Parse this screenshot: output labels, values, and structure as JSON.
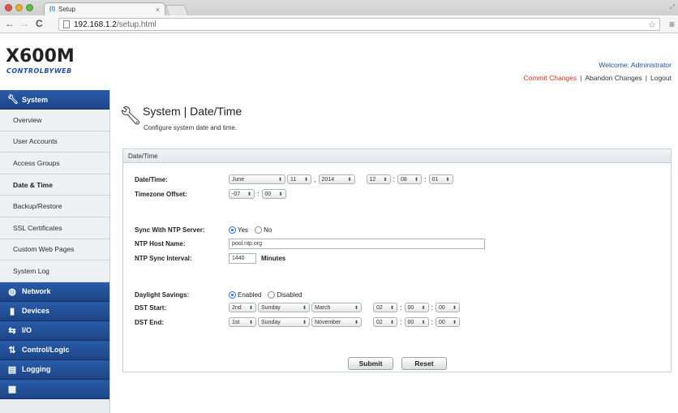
{
  "browser": {
    "tab_title": "Setup",
    "favicon_text": "(!)",
    "url_host": "192.168.1.2",
    "url_path": "/setup.html"
  },
  "colors": {
    "brand_blue": "#1f4d9b",
    "sidebar_section": "#2a5ca8",
    "commit_red": "#d4321f"
  },
  "header": {
    "logo_main": "X600M",
    "logo_sub": "CONTROLBYWEB",
    "welcome": "Welcome: Administrator",
    "commit": "Commit Changes",
    "abandon": "Abandon Changes",
    "logout": "Logout",
    "sep": "|"
  },
  "sidebar": {
    "system": "System",
    "items": [
      "Overview",
      "User Accounts",
      "Access Groups",
      "Date & Time",
      "Backup/Restore",
      "SSL Certificates",
      "Custom Web Pages",
      "System Log"
    ],
    "sections": [
      "Network",
      "Devices",
      "I/O",
      "Control/Logic",
      "Logging"
    ]
  },
  "page": {
    "title": "System | Date/Time",
    "description": "Configure system date and time.",
    "panel_title": "Date/Time"
  },
  "form": {
    "datetime": {
      "label": "Date/Time:",
      "month": "June",
      "day": "11",
      "year": "2014",
      "hour": "12",
      "minute": "08",
      "second": "01"
    },
    "timezone": {
      "label": "Timezone Offset:",
      "hours": "-07",
      "minutes": "00"
    },
    "ntp_sync": {
      "label": "Sync With NTP Server:",
      "yes": "Yes",
      "no": "No"
    },
    "ntp_host": {
      "label": "NTP Host Name:",
      "value": "pool.ntp.org"
    },
    "ntp_interval": {
      "label": "NTP Sync Interval:",
      "value": "1440",
      "unit": "Minutes"
    },
    "dst": {
      "label": "Daylight Savings:",
      "enabled": "Enabled",
      "disabled": "Disabled"
    },
    "dst_start": {
      "label": "DST Start:",
      "week": "2nd",
      "day": "Sunday",
      "month": "March",
      "hour": "02",
      "minute": "00",
      "second": "00"
    },
    "dst_end": {
      "label": "DST End:",
      "week": "1st",
      "day": "Sunday",
      "month": "November",
      "hour": "02",
      "minute": "00",
      "second": "00"
    },
    "submit": "Submit",
    "reset": "Reset"
  }
}
